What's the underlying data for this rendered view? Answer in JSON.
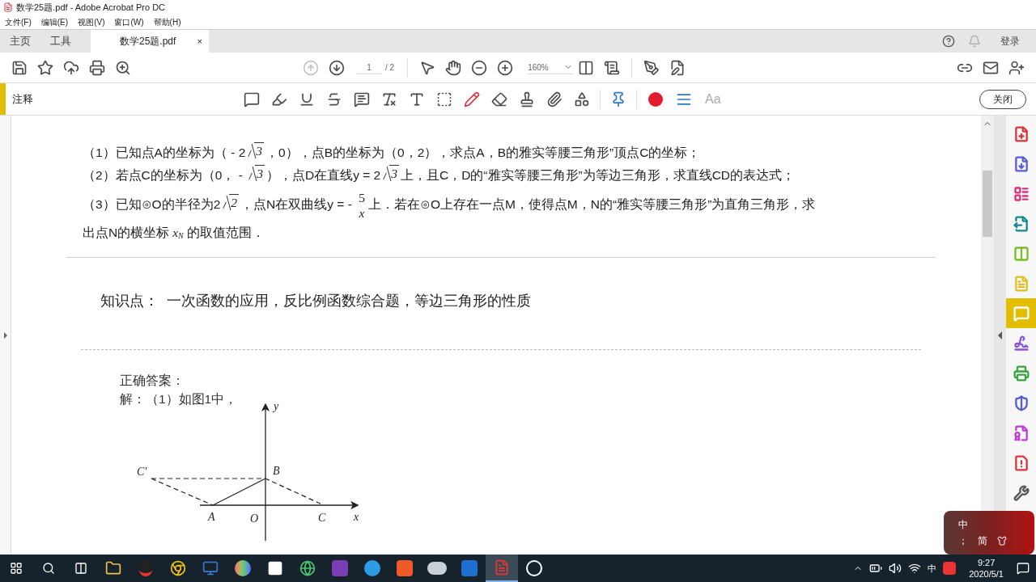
{
  "window": {
    "title": "数学25题.pdf - Adobe Acrobat Pro DC"
  },
  "menu": [
    "文件(F)",
    "编辑(E)",
    "视图(V)",
    "窗口(W)",
    "帮助(H)"
  ],
  "tabs": [
    {
      "label": "主页",
      "kind": "nav",
      "selected": false
    },
    {
      "label": "工具",
      "kind": "nav",
      "selected": false
    },
    {
      "label": "数学25题.pdf",
      "kind": "document",
      "selected": true,
      "close": "×"
    }
  ],
  "account": {
    "login": "登录"
  },
  "toolbar": {
    "nav": [
      {
        "kind": "prev",
        "disabled": true
      },
      {
        "kind": "next",
        "disabled": false
      }
    ],
    "page": "1",
    "page_total": "/ 2",
    "zoom": "160%"
  },
  "comment_bar": {
    "title": "注释",
    "font_button": "Aa",
    "close": "关闭"
  },
  "problems": [
    {
      "parts": [
        {
          "kind": "text",
          "text": "（1）已知点A的坐标为（ - 2"
        },
        {
          "kind": "sqrt",
          "text": "3"
        },
        {
          "kind": "text",
          "text": "，0），点B的坐标为（0，2），求点A，B的雅实等腰三角形”顶点C的坐标；"
        }
      ]
    },
    {
      "parts": [
        {
          "kind": "text",
          "text": "（2）若点C的坐标为（0， - "
        },
        {
          "kind": "sqrt",
          "text": "3"
        },
        {
          "kind": "text",
          "text": "），点D在直线y = 2"
        },
        {
          "kind": "sqrt",
          "text": "3"
        },
        {
          "kind": "text",
          "text": "上，且C，D的“雅实等腰三角形”为等边三角形，求直线CD的表达式；"
        }
      ]
    },
    {
      "parts": [
        {
          "kind": "text",
          "text": "（3）已知⊙O的半径为2"
        },
        {
          "kind": "sqrt",
          "text": "2"
        },
        {
          "kind": "text",
          "text": "，点N在双曲线y = - "
        },
        {
          "kind": "frac",
          "num": "5",
          "den": "x"
        },
        {
          "kind": "text",
          "text": "上．若在⊙O上存在一点M，使得点M，N的“雅实等腰三角形”为直角三角形，求"
        },
        {
          "kind": "break"
        },
        {
          "kind": "text",
          "text": "出点N的横坐标"
        },
        {
          "kind": "var",
          "text": "x",
          "sub": "N"
        },
        {
          "kind": "text",
          "text": "的取值范围．"
        }
      ]
    }
  ],
  "knowledge": "知识点：  一次函数的应用，反比例函数综合题，等边三角形的性质",
  "answer": {
    "heading": "正确答案：",
    "lines": [
      "解：（1）如图1中，"
    ]
  },
  "figure": {
    "labels": {
      "y": "y",
      "x": "x",
      "origin": "O",
      "a": "A",
      "b": "B",
      "c": "C",
      "c_prime": "C'"
    }
  },
  "right_tools": [
    {
      "kind": "create",
      "color": "#d9343f",
      "selected": false
    },
    {
      "kind": "export",
      "color": "#5b5bd6",
      "selected": false
    },
    {
      "kind": "organize",
      "color": "#d6327f",
      "selected": false
    },
    {
      "kind": "send",
      "color": "#14878f",
      "selected": false
    },
    {
      "kind": "compare",
      "color": "#7bbd2b",
      "selected": false
    },
    {
      "kind": "review",
      "color": "#dcc023",
      "selected": false
    },
    {
      "kind": "comment",
      "color": "#e3bd00",
      "selected": true
    },
    {
      "kind": "sign",
      "color": "#8a55d6",
      "selected": false
    },
    {
      "kind": "print",
      "color": "#36a540",
      "selected": false
    },
    {
      "kind": "protect",
      "color": "#5b5bd6",
      "selected": false
    },
    {
      "kind": "rich",
      "color": "#c03bd6",
      "selected": false
    },
    {
      "kind": "info",
      "color": "#d9343f",
      "selected": false
    },
    {
      "kind": "more",
      "color": "#555555",
      "selected": false
    }
  ],
  "ime": {
    "mode": "中",
    "punct": "；",
    "script": "简"
  },
  "taskbar": {
    "tray_ime": "中",
    "time": "9:27",
    "date": "2020/5/1"
  }
}
